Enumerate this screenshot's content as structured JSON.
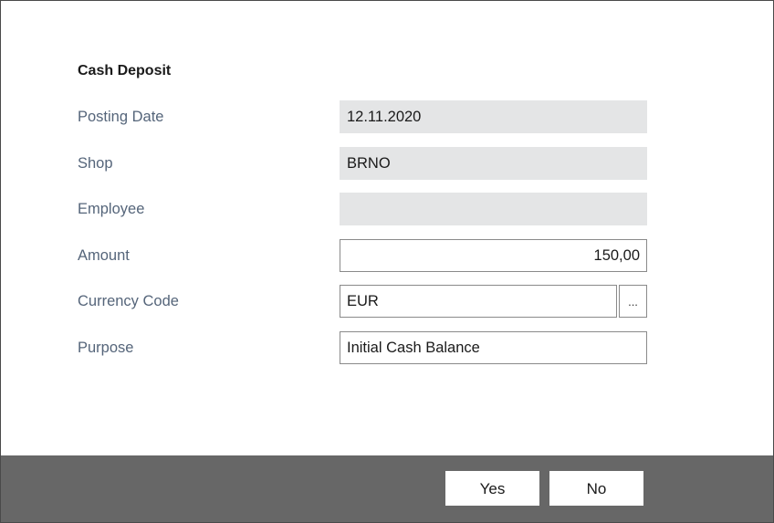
{
  "dialog": {
    "title": "Cash Deposit"
  },
  "fields": {
    "posting_date": {
      "label": "Posting Date",
      "value": "12.11.2020"
    },
    "shop": {
      "label": "Shop",
      "value": "BRNO"
    },
    "employee": {
      "label": "Employee",
      "value": ""
    },
    "amount": {
      "label": "Amount",
      "value": "150,00"
    },
    "currency_code": {
      "label": "Currency Code",
      "value": "EUR",
      "lookup_label": "..."
    },
    "purpose": {
      "label": "Purpose",
      "value": "Initial Cash Balance"
    }
  },
  "footer": {
    "yes_label": "Yes",
    "no_label": "No"
  }
}
